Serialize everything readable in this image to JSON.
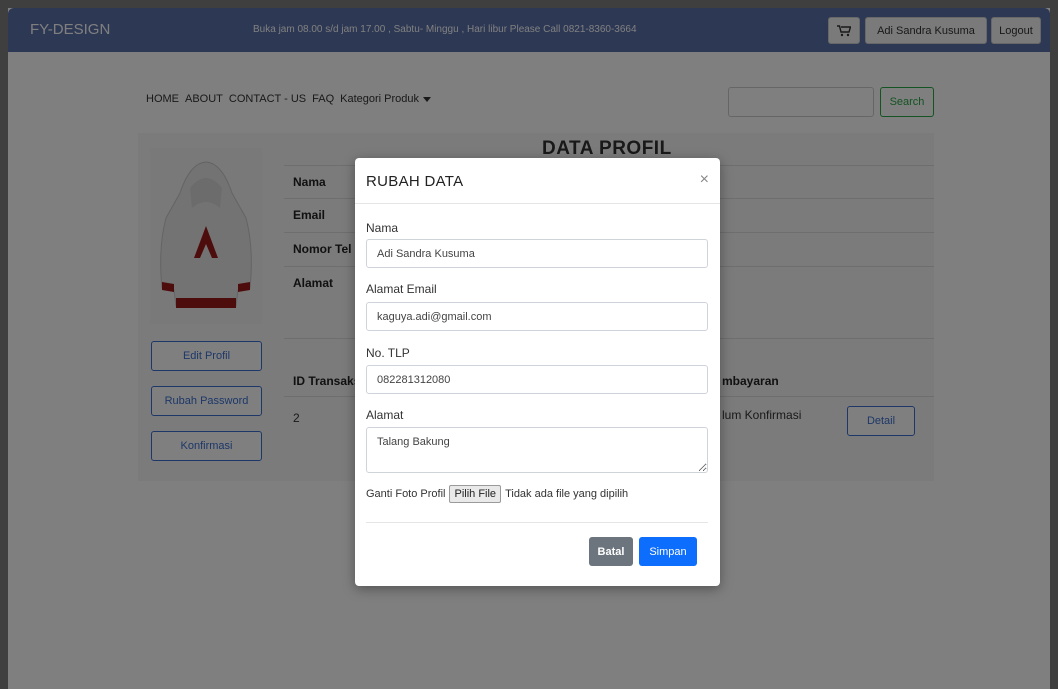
{
  "header": {
    "brand": "FY-DESIGN",
    "announcement": "Buka jam 08.00 s/d jam 17.00 , Sabtu- Minggu , Hari libur Please Call 0821-8360-3664",
    "cart_icon": "cart-icon",
    "user_name": "Adi Sandra Kusuma",
    "logout": "Logout"
  },
  "nav": {
    "items": [
      "HOME",
      "ABOUT",
      "CONTACT - US",
      "FAQ"
    ],
    "category": "Kategori Produk",
    "search_label": "Search"
  },
  "profile": {
    "title": "DATA PROFIL",
    "fields": [
      "Nama",
      "Email",
      "Nomor Tel",
      "Alamat"
    ],
    "buttons": [
      "Edit Profil",
      "Rubah Password",
      "Konfirmasi"
    ]
  },
  "transactions": {
    "col_id": "ID Transaks",
    "col_payment": "mbayaran",
    "row_id": "2",
    "row_status": "lum Konfirmasi",
    "detail": "Detail"
  },
  "modal": {
    "title": "RUBAH DATA",
    "close": "×",
    "name_label": "Nama",
    "name_value": "Adi Sandra Kusuma",
    "email_label": "Alamat Email",
    "email_value": "kaguya.adi@gmail.com",
    "phone_label": "No. TLP",
    "phone_value": "082281312080",
    "address_label": "Alamat",
    "address_value": "Talang Bakung",
    "photo_label": "Ganti Foto Profil",
    "file_button": "Pilih File",
    "file_status": "Tidak ada file yang dipilih",
    "cancel": "Batal",
    "save": "Simpan"
  },
  "colors": {
    "topbar": "#5a70a8",
    "primary": "#0d6efd",
    "secondary": "#6c757d",
    "success": "#28a745",
    "overlay": "rgba(0,0,0,0.5)"
  }
}
